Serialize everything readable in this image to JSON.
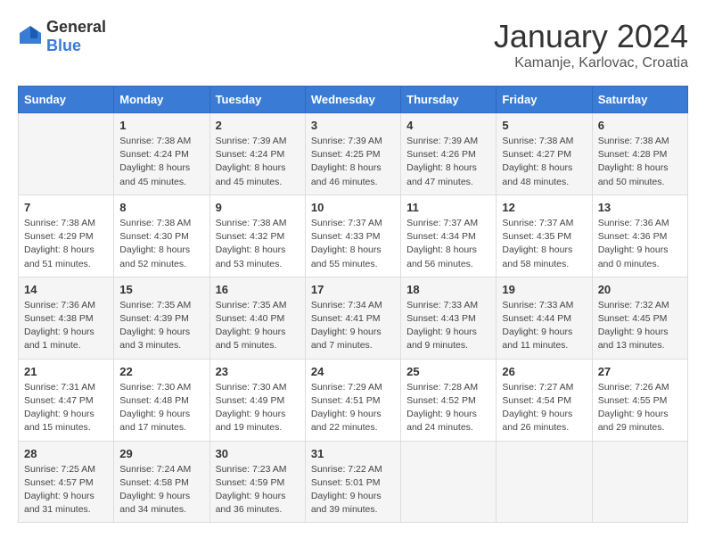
{
  "header": {
    "logo_general": "General",
    "logo_blue": "Blue",
    "month_title": "January 2024",
    "location": "Kamanje, Karlovac, Croatia"
  },
  "days_of_week": [
    "Sunday",
    "Monday",
    "Tuesday",
    "Wednesday",
    "Thursday",
    "Friday",
    "Saturday"
  ],
  "weeks": [
    [
      {
        "day": "",
        "info": ""
      },
      {
        "day": "1",
        "info": "Sunrise: 7:38 AM\nSunset: 4:24 PM\nDaylight: 8 hours\nand 45 minutes."
      },
      {
        "day": "2",
        "info": "Sunrise: 7:39 AM\nSunset: 4:24 PM\nDaylight: 8 hours\nand 45 minutes."
      },
      {
        "day": "3",
        "info": "Sunrise: 7:39 AM\nSunset: 4:25 PM\nDaylight: 8 hours\nand 46 minutes."
      },
      {
        "day": "4",
        "info": "Sunrise: 7:39 AM\nSunset: 4:26 PM\nDaylight: 8 hours\nand 47 minutes."
      },
      {
        "day": "5",
        "info": "Sunrise: 7:38 AM\nSunset: 4:27 PM\nDaylight: 8 hours\nand 48 minutes."
      },
      {
        "day": "6",
        "info": "Sunrise: 7:38 AM\nSunset: 4:28 PM\nDaylight: 8 hours\nand 50 minutes."
      }
    ],
    [
      {
        "day": "7",
        "info": "Sunrise: 7:38 AM\nSunset: 4:29 PM\nDaylight: 8 hours\nand 51 minutes."
      },
      {
        "day": "8",
        "info": "Sunrise: 7:38 AM\nSunset: 4:30 PM\nDaylight: 8 hours\nand 52 minutes."
      },
      {
        "day": "9",
        "info": "Sunrise: 7:38 AM\nSunset: 4:32 PM\nDaylight: 8 hours\nand 53 minutes."
      },
      {
        "day": "10",
        "info": "Sunrise: 7:37 AM\nSunset: 4:33 PM\nDaylight: 8 hours\nand 55 minutes."
      },
      {
        "day": "11",
        "info": "Sunrise: 7:37 AM\nSunset: 4:34 PM\nDaylight: 8 hours\nand 56 minutes."
      },
      {
        "day": "12",
        "info": "Sunrise: 7:37 AM\nSunset: 4:35 PM\nDaylight: 8 hours\nand 58 minutes."
      },
      {
        "day": "13",
        "info": "Sunrise: 7:36 AM\nSunset: 4:36 PM\nDaylight: 9 hours\nand 0 minutes."
      }
    ],
    [
      {
        "day": "14",
        "info": "Sunrise: 7:36 AM\nSunset: 4:38 PM\nDaylight: 9 hours\nand 1 minute."
      },
      {
        "day": "15",
        "info": "Sunrise: 7:35 AM\nSunset: 4:39 PM\nDaylight: 9 hours\nand 3 minutes."
      },
      {
        "day": "16",
        "info": "Sunrise: 7:35 AM\nSunset: 4:40 PM\nDaylight: 9 hours\nand 5 minutes."
      },
      {
        "day": "17",
        "info": "Sunrise: 7:34 AM\nSunset: 4:41 PM\nDaylight: 9 hours\nand 7 minutes."
      },
      {
        "day": "18",
        "info": "Sunrise: 7:33 AM\nSunset: 4:43 PM\nDaylight: 9 hours\nand 9 minutes."
      },
      {
        "day": "19",
        "info": "Sunrise: 7:33 AM\nSunset: 4:44 PM\nDaylight: 9 hours\nand 11 minutes."
      },
      {
        "day": "20",
        "info": "Sunrise: 7:32 AM\nSunset: 4:45 PM\nDaylight: 9 hours\nand 13 minutes."
      }
    ],
    [
      {
        "day": "21",
        "info": "Sunrise: 7:31 AM\nSunset: 4:47 PM\nDaylight: 9 hours\nand 15 minutes."
      },
      {
        "day": "22",
        "info": "Sunrise: 7:30 AM\nSunset: 4:48 PM\nDaylight: 9 hours\nand 17 minutes."
      },
      {
        "day": "23",
        "info": "Sunrise: 7:30 AM\nSunset: 4:49 PM\nDaylight: 9 hours\nand 19 minutes."
      },
      {
        "day": "24",
        "info": "Sunrise: 7:29 AM\nSunset: 4:51 PM\nDaylight: 9 hours\nand 22 minutes."
      },
      {
        "day": "25",
        "info": "Sunrise: 7:28 AM\nSunset: 4:52 PM\nDaylight: 9 hours\nand 24 minutes."
      },
      {
        "day": "26",
        "info": "Sunrise: 7:27 AM\nSunset: 4:54 PM\nDaylight: 9 hours\nand 26 minutes."
      },
      {
        "day": "27",
        "info": "Sunrise: 7:26 AM\nSunset: 4:55 PM\nDaylight: 9 hours\nand 29 minutes."
      }
    ],
    [
      {
        "day": "28",
        "info": "Sunrise: 7:25 AM\nSunset: 4:57 PM\nDaylight: 9 hours\nand 31 minutes."
      },
      {
        "day": "29",
        "info": "Sunrise: 7:24 AM\nSunset: 4:58 PM\nDaylight: 9 hours\nand 34 minutes."
      },
      {
        "day": "30",
        "info": "Sunrise: 7:23 AM\nSunset: 4:59 PM\nDaylight: 9 hours\nand 36 minutes."
      },
      {
        "day": "31",
        "info": "Sunrise: 7:22 AM\nSunset: 5:01 PM\nDaylight: 9 hours\nand 39 minutes."
      },
      {
        "day": "",
        "info": ""
      },
      {
        "day": "",
        "info": ""
      },
      {
        "day": "",
        "info": ""
      }
    ]
  ]
}
